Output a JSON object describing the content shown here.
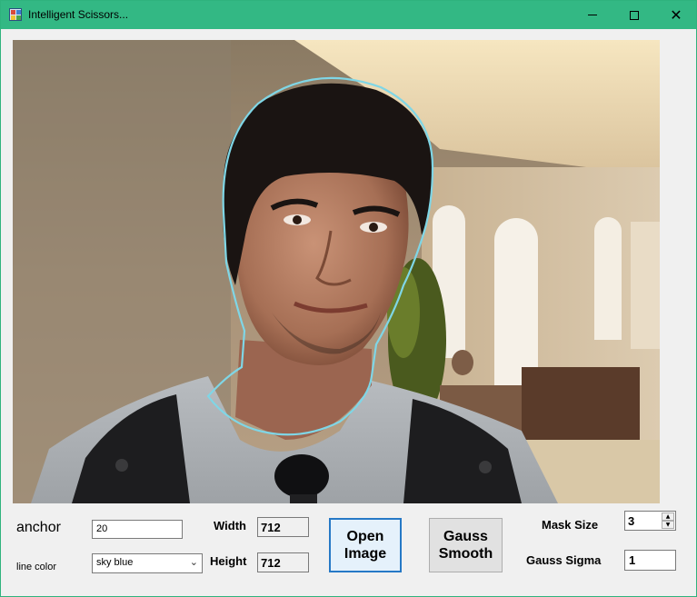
{
  "window": {
    "title": "Intelligent Scissors...",
    "icon": "app-icon",
    "controls": [
      "minimize-icon",
      "maximize-icon",
      "close-icon"
    ]
  },
  "image_panel": {
    "content": "portrait photo with sky-blue scissors contour around head and neck",
    "contour_color": "#7fd6e6"
  },
  "controls": {
    "anchor_label": "anchor",
    "anchor_value": "20",
    "line_color_label": "line color",
    "line_color_value": "sky blue",
    "width_label": "Width",
    "width_value": "712",
    "height_label": "Height",
    "height_value": "712",
    "open_button": "Open Image",
    "gauss_button": "Gauss Smooth",
    "mask_size_label": "Mask Size",
    "mask_size_value": "3",
    "gauss_sigma_label": "Gauss Sigma",
    "gauss_sigma_value": "1"
  },
  "colors": {
    "titlebar": "#33b884",
    "accent_border": "#2679c6",
    "window_bg": "#f0f0f0"
  }
}
